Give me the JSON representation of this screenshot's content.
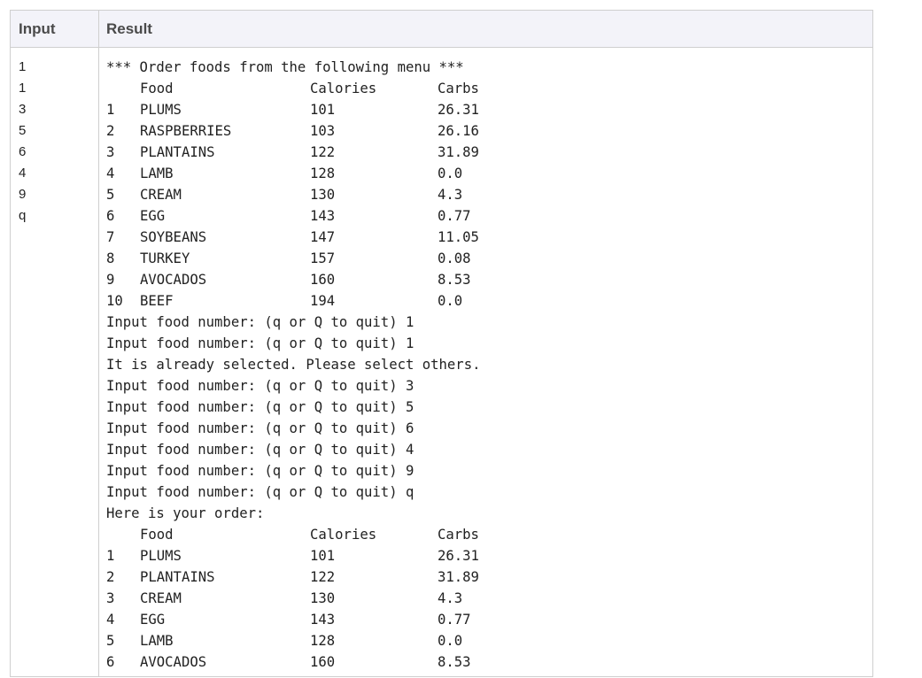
{
  "table": {
    "headers": {
      "input": "Input",
      "result": "Result"
    },
    "inputs": [
      "1",
      "1",
      "3",
      "5",
      "6",
      "4",
      "9",
      "q"
    ],
    "result": {
      "menu_title": "*** Order foods from the following menu ***",
      "columns": {
        "food": "Food",
        "calories": "Calories",
        "carbs": "Carbs"
      },
      "menu": [
        {
          "num": "1",
          "food": "PLUMS",
          "calories": "101",
          "carbs": "26.31"
        },
        {
          "num": "2",
          "food": "RASPBERRIES",
          "calories": "103",
          "carbs": "26.16"
        },
        {
          "num": "3",
          "food": "PLANTAINS",
          "calories": "122",
          "carbs": "31.89"
        },
        {
          "num": "4",
          "food": "LAMB",
          "calories": "128",
          "carbs": "0.0"
        },
        {
          "num": "5",
          "food": "CREAM",
          "calories": "130",
          "carbs": "4.3"
        },
        {
          "num": "6",
          "food": "EGG",
          "calories": "143",
          "carbs": "0.77"
        },
        {
          "num": "7",
          "food": "SOYBEANS",
          "calories": "147",
          "carbs": "11.05"
        },
        {
          "num": "8",
          "food": "TURKEY",
          "calories": "157",
          "carbs": "0.08"
        },
        {
          "num": "9",
          "food": "AVOCADOS",
          "calories": "160",
          "carbs": "8.53"
        },
        {
          "num": "10",
          "food": "BEEF",
          "calories": "194",
          "carbs": "0.0"
        }
      ],
      "prompts": [
        "Input food number: (q or Q to quit) 1",
        "Input food number: (q or Q to quit) 1",
        "It is already selected. Please select others.",
        "Input food number: (q or Q to quit) 3",
        "Input food number: (q or Q to quit) 5",
        "Input food number: (q or Q to quit) 6",
        "Input food number: (q or Q to quit) 4",
        "Input food number: (q or Q to quit) 9",
        "Input food number: (q or Q to quit) q"
      ],
      "order_title": "Here is your order:",
      "order": [
        {
          "num": "1",
          "food": "PLUMS",
          "calories": "101",
          "carbs": "26.31"
        },
        {
          "num": "2",
          "food": "PLANTAINS",
          "calories": "122",
          "carbs": "31.89"
        },
        {
          "num": "3",
          "food": "CREAM",
          "calories": "130",
          "carbs": "4.3"
        },
        {
          "num": "4",
          "food": "EGG",
          "calories": "143",
          "carbs": "0.77"
        },
        {
          "num": "5",
          "food": "LAMB",
          "calories": "128",
          "carbs": "0.0"
        },
        {
          "num": "6",
          "food": "AVOCADOS",
          "calories": "160",
          "carbs": "8.53"
        }
      ]
    }
  }
}
